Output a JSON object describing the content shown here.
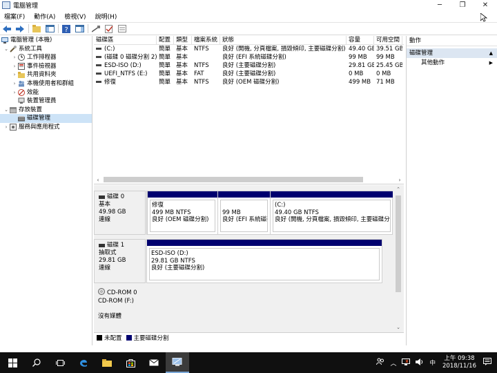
{
  "window": {
    "title": "電腦管理",
    "controls": {
      "minimize": "─",
      "restore": "❐",
      "close": "✕"
    }
  },
  "menu": [
    "檔案(F)",
    "動作(A)",
    "檢視(V)",
    "說明(H)"
  ],
  "tree": [
    {
      "label": "電腦管理 (本機)",
      "level": 0,
      "expander": "",
      "icon": "computer-icon"
    },
    {
      "label": "系統工具",
      "level": 1,
      "expander": "⌄",
      "icon": "tools-icon"
    },
    {
      "label": "工作排程器",
      "level": 2,
      "expander": "›",
      "icon": "clock-icon"
    },
    {
      "label": "事件檢視器",
      "level": 2,
      "expander": "›",
      "icon": "event-icon"
    },
    {
      "label": "共用資料夾",
      "level": 2,
      "expander": "›",
      "icon": "folder-icon"
    },
    {
      "label": "本機使用者和群組",
      "level": 2,
      "expander": "›",
      "icon": "users-icon"
    },
    {
      "label": "效能",
      "level": 2,
      "expander": "›",
      "icon": "perf-icon"
    },
    {
      "label": "裝置管理員",
      "level": 2,
      "expander": "",
      "icon": "device-icon"
    },
    {
      "label": "存放裝置",
      "level": 1,
      "expander": "⌄",
      "icon": "storage-icon"
    },
    {
      "label": "磁碟管理",
      "level": 2,
      "expander": "",
      "icon": "disk-icon",
      "selected": true
    },
    {
      "label": "服務與應用程式",
      "level": 1,
      "expander": "›",
      "icon": "services-icon"
    }
  ],
  "volume_columns": [
    "磁碟區",
    "配置",
    "類型",
    "檔案系統",
    "狀態",
    "容量",
    "可用空間"
  ],
  "volumes": [
    {
      "name": "(C:)",
      "layout": "簡單",
      "type": "基本",
      "fs": "NTFS",
      "status": "良好 (開機, 分頁檔案, 損毀傾印, 主要磁碟分割)",
      "capacity": "49.40 GB",
      "free": "39.51 GB"
    },
    {
      "name": "(磁碟 0 磁碟分割 2)",
      "layout": "簡單",
      "type": "基本",
      "fs": "",
      "status": "良好 (EFI 系統磁碟分割)",
      "capacity": "99 MB",
      "free": "99 MB"
    },
    {
      "name": "ESD-ISO (D:)",
      "layout": "簡單",
      "type": "基本",
      "fs": "NTFS",
      "status": "良好 (主要磁碟分割)",
      "capacity": "29.81 GB",
      "free": "25.45 GB"
    },
    {
      "name": "UEFI_NTFS (E:)",
      "layout": "簡單",
      "type": "基本",
      "fs": "FAT",
      "status": "良好 (主要磁碟分割)",
      "capacity": "0 MB",
      "free": "0 MB"
    },
    {
      "name": "修復",
      "layout": "簡單",
      "type": "基本",
      "fs": "NTFS",
      "status": "良好 (OEM 磁碟分割)",
      "capacity": "499 MB",
      "free": "71 MB"
    }
  ],
  "disks": [
    {
      "name": "磁碟 0",
      "type": "基本",
      "size": "49.98 GB",
      "state": "連線",
      "partitions": [
        {
          "line1": "修復",
          "line2": "499 MB NTFS",
          "line3": "良好 (OEM 磁碟分割)"
        },
        {
          "line1": "",
          "line2": "99 MB",
          "line3": "良好 (EFI 系統磁碟分割)"
        },
        {
          "line1": "(C:)",
          "line2": "49.40 GB NTFS",
          "line3": "良好 (開機, 分頁檔案, 損毀傾印, 主要磁碟分割)"
        }
      ]
    },
    {
      "name": "磁碟 1",
      "type": "抽取式",
      "size": "29.81 GB",
      "state": "連線",
      "partitions": [
        {
          "line1": "ESD-ISO  (D:)",
          "line2": "29.81 GB NTFS",
          "line3": "良好 (主要磁碟分割)"
        }
      ]
    },
    {
      "name": "CD-ROM 0",
      "type": "CD-ROM (F:)",
      "size": "",
      "state": "沒有媒體",
      "partitions": []
    }
  ],
  "legend": [
    {
      "label": "未配置",
      "color": "#000000"
    },
    {
      "label": "主要磁碟分割",
      "color": "#00006f"
    }
  ],
  "actions": {
    "title": "動作",
    "section": "磁碟管理",
    "item": "其他動作"
  },
  "taskbar": {
    "time": "上午 09:38",
    "date": "2018/11/16",
    "ime": "中"
  }
}
